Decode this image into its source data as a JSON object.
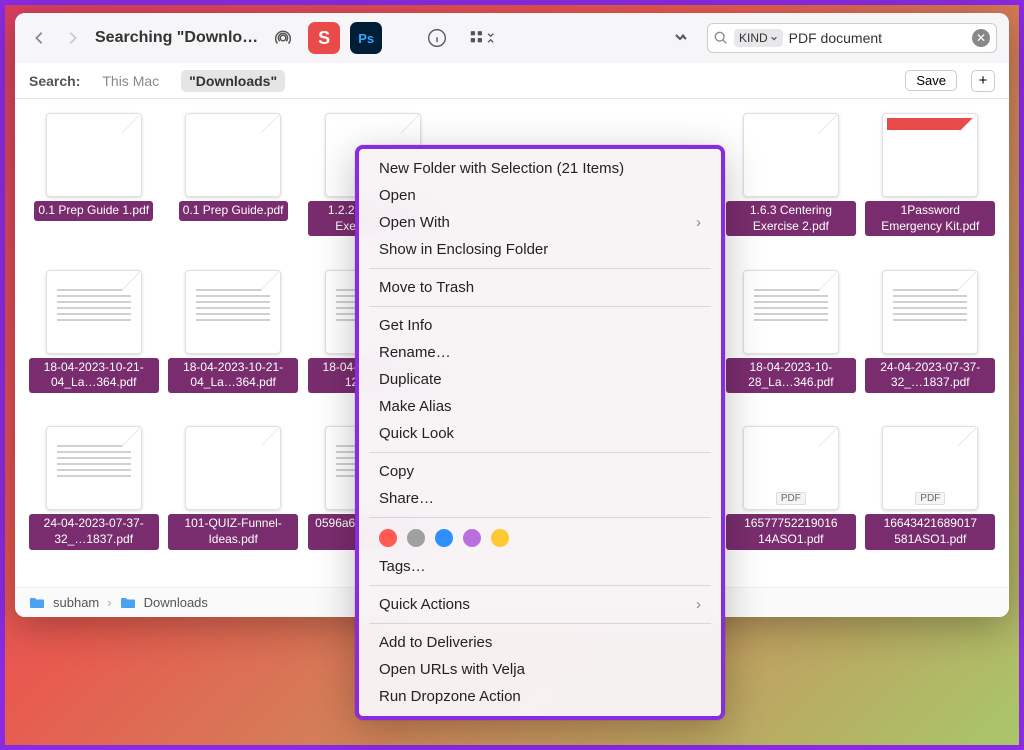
{
  "toolbar": {
    "title": "Searching \"Downlo…",
    "app_icon_s": "S",
    "app_icon_ps": "Ps",
    "search": {
      "kind_label": "KIND",
      "value": "PDF document"
    }
  },
  "scope": {
    "label": "Search:",
    "this_mac": "This Mac",
    "downloads": "\"Downloads\"",
    "save": "Save",
    "plus": "+"
  },
  "files": [
    {
      "name": "0.1 Prep Guide 1.pdf",
      "style": "plain"
    },
    {
      "name": "0.1 Prep Guide.pdf",
      "style": "plain"
    },
    {
      "name": "1.2.2 - Centering Exercise…pdf",
      "style": "plain"
    },
    {
      "name": "",
      "style": "hidden"
    },
    {
      "name": "",
      "style": "hidden"
    },
    {
      "name": "1.6.3 Centering Exercise 2.pdf",
      "style": "plain"
    },
    {
      "name": "1Password Emergency Kit.pdf",
      "style": "red"
    },
    {
      "name": "18-04-2023-10-21-04_La…364.pdf",
      "style": "lines"
    },
    {
      "name": "18-04-2023-10-21-04_La…364.pdf",
      "style": "lines"
    },
    {
      "name": "18-04-2023-10-22-12_L…pdf",
      "style": "lines"
    },
    {
      "name": "",
      "style": "hidden"
    },
    {
      "name": "",
      "style": "hidden"
    },
    {
      "name": "18-04-2023-10-28_La…346.pdf",
      "style": "lines"
    },
    {
      "name": "24-04-2023-07-37-32_…1837.pdf",
      "style": "lines"
    },
    {
      "name": "24-04-2023-07-37-32_…1837.pdf",
      "style": "lines"
    },
    {
      "name": "101-QUIZ-Funnel-Ideas.pdf",
      "style": "plain"
    },
    {
      "name": "0596a614…409d-9…pdf",
      "style": "lines"
    },
    {
      "name": "",
      "style": "hidden"
    },
    {
      "name": "",
      "style": "hidden"
    },
    {
      "name": "16577752219016 14ASO1.pdf",
      "style": "pdf"
    },
    {
      "name": "16643421689017 581ASO1.pdf",
      "style": "pdf"
    }
  ],
  "pathbar": {
    "user": "subham",
    "folder": "Downloads"
  },
  "menu": {
    "new_folder": "New Folder with Selection (21 Items)",
    "open": "Open",
    "open_with": "Open With",
    "show_enclosing": "Show in Enclosing Folder",
    "trash": "Move to Trash",
    "get_info": "Get Info",
    "rename": "Rename…",
    "duplicate": "Duplicate",
    "alias": "Make Alias",
    "quick_look": "Quick Look",
    "copy": "Copy",
    "share": "Share…",
    "tags": "Tags…",
    "quick_actions": "Quick Actions",
    "deliveries": "Add to Deliveries",
    "velja": "Open URLs with Velja",
    "dropzone": "Run Dropzone Action",
    "tag_colors": [
      "#ff5b53",
      "#a0a0a0",
      "#2f8fff",
      "#b96fde",
      "#ffc933"
    ]
  }
}
